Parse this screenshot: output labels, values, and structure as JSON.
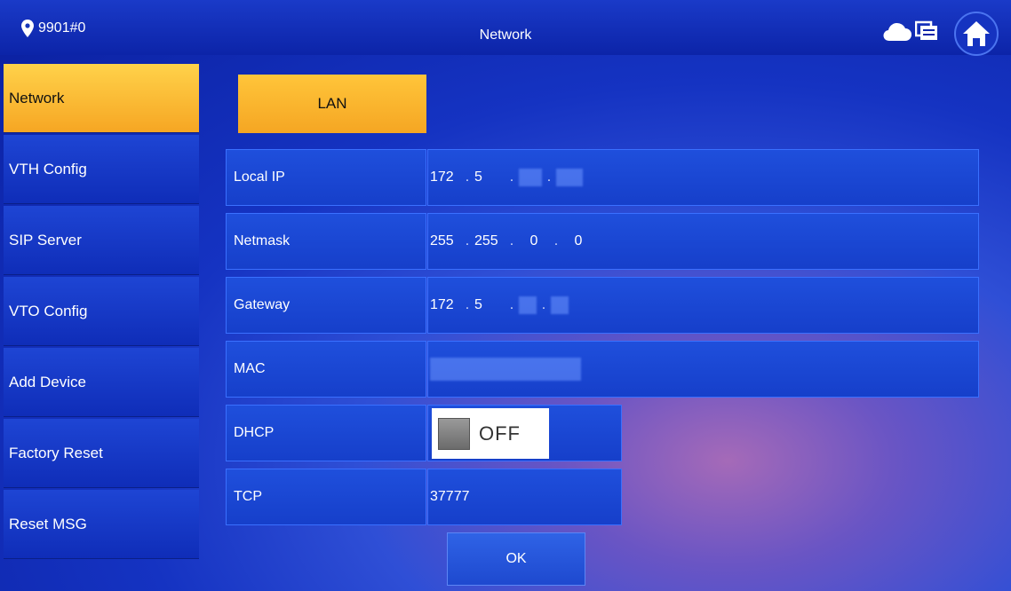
{
  "header": {
    "location": "9901#0",
    "title": "Network",
    "icons": [
      "map-pin-icon",
      "cloud-icon",
      "screen-icon",
      "home-icon"
    ]
  },
  "sidebar": {
    "items": [
      {
        "label": "Network",
        "active": true
      },
      {
        "label": "VTH Config",
        "active": false
      },
      {
        "label": "SIP Server",
        "active": false
      },
      {
        "label": "VTO Config",
        "active": false
      },
      {
        "label": "Add Device",
        "active": false
      },
      {
        "label": "Factory Reset",
        "active": false
      },
      {
        "label": "Reset MSG",
        "active": false
      }
    ]
  },
  "tab": {
    "label": "LAN"
  },
  "form": {
    "local_ip": {
      "label": "Local IP",
      "octets": [
        "172",
        "5"
      ]
    },
    "netmask": {
      "label": "Netmask",
      "octets": [
        "255",
        "255",
        "0",
        "0"
      ]
    },
    "gateway": {
      "label": "Gateway",
      "octets": [
        "172",
        "5"
      ]
    },
    "mac": {
      "label": "MAC"
    },
    "dhcp": {
      "label": "DHCP",
      "state": "OFF"
    },
    "tcp": {
      "label": "TCP",
      "value": "37777"
    }
  },
  "ok_button": {
    "label": "OK"
  },
  "colors": {
    "accent": "#f5a623",
    "background": "#1533c2",
    "bar": "#0c24a8"
  }
}
